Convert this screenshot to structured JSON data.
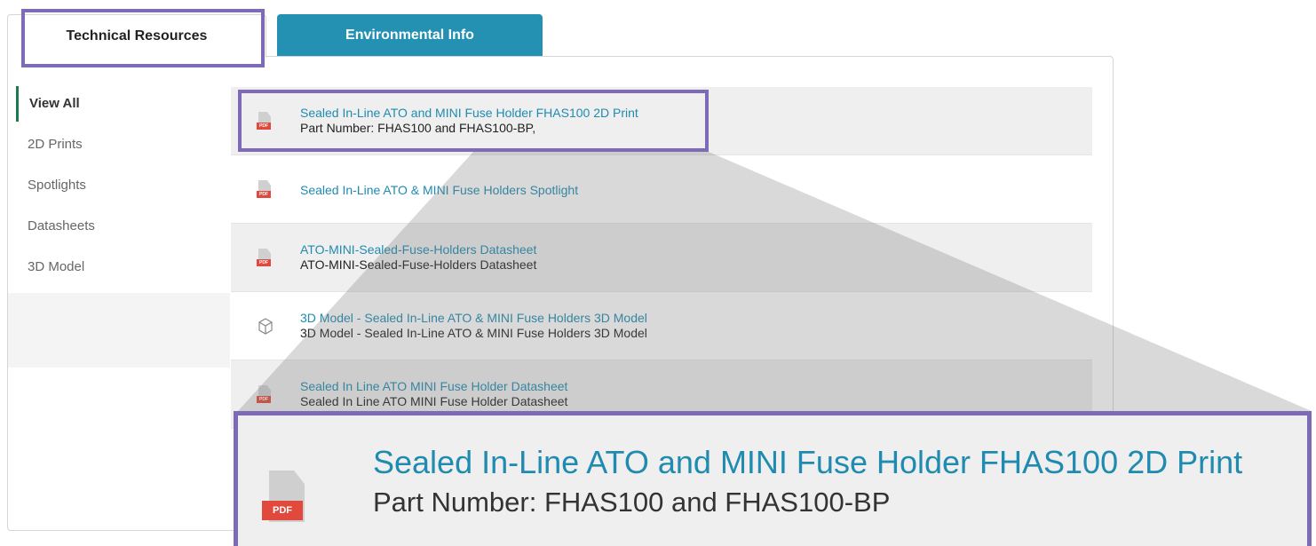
{
  "tabs": {
    "technical": "Technical Resources",
    "environmental": "Environmental Info"
  },
  "sidebar": {
    "items": [
      {
        "label": "View All"
      },
      {
        "label": "2D Prints"
      },
      {
        "label": "Spotlights"
      },
      {
        "label": "Datasheets"
      },
      {
        "label": "3D Model"
      }
    ]
  },
  "resources": [
    {
      "title": "Sealed In-Line ATO and MINI Fuse Holder FHAS100 2D Print",
      "sub": "Part Number: FHAS100 and FHAS100-BP,",
      "icon": "pdf-icon"
    },
    {
      "title": "Sealed In-Line ATO & MINI Fuse Holders Spotlight",
      "sub": "",
      "icon": "pdf-icon"
    },
    {
      "title": "ATO-MINI-Sealed-Fuse-Holders Datasheet",
      "sub": "ATO-MINI-Sealed-Fuse-Holders Datasheet",
      "icon": "pdf-icon"
    },
    {
      "title": "3D Model - Sealed In-Line ATO & MINI Fuse Holders 3D Model",
      "sub": "3D Model - Sealed In-Line ATO & MINI Fuse Holders 3D Model",
      "icon": "cube-icon"
    },
    {
      "title": "Sealed In Line ATO MINI Fuse Holder Datasheet",
      "sub": "Sealed In Line ATO MINI Fuse Holder Datasheet",
      "icon": "pdf-icon"
    }
  ],
  "pdf_tag": "PDF",
  "zoom": {
    "title": "Sealed In-Line ATO and MINI Fuse Holder FHAS100 2D Print",
    "sub": "Part Number: FHAS100 and FHAS100-BP"
  },
  "colors": {
    "accent": "#2491b3",
    "link": "#1f8bb0",
    "highlight": "#7e6bb5",
    "pdf_red": "#e0493c",
    "active_marker": "#1a7a4e"
  }
}
